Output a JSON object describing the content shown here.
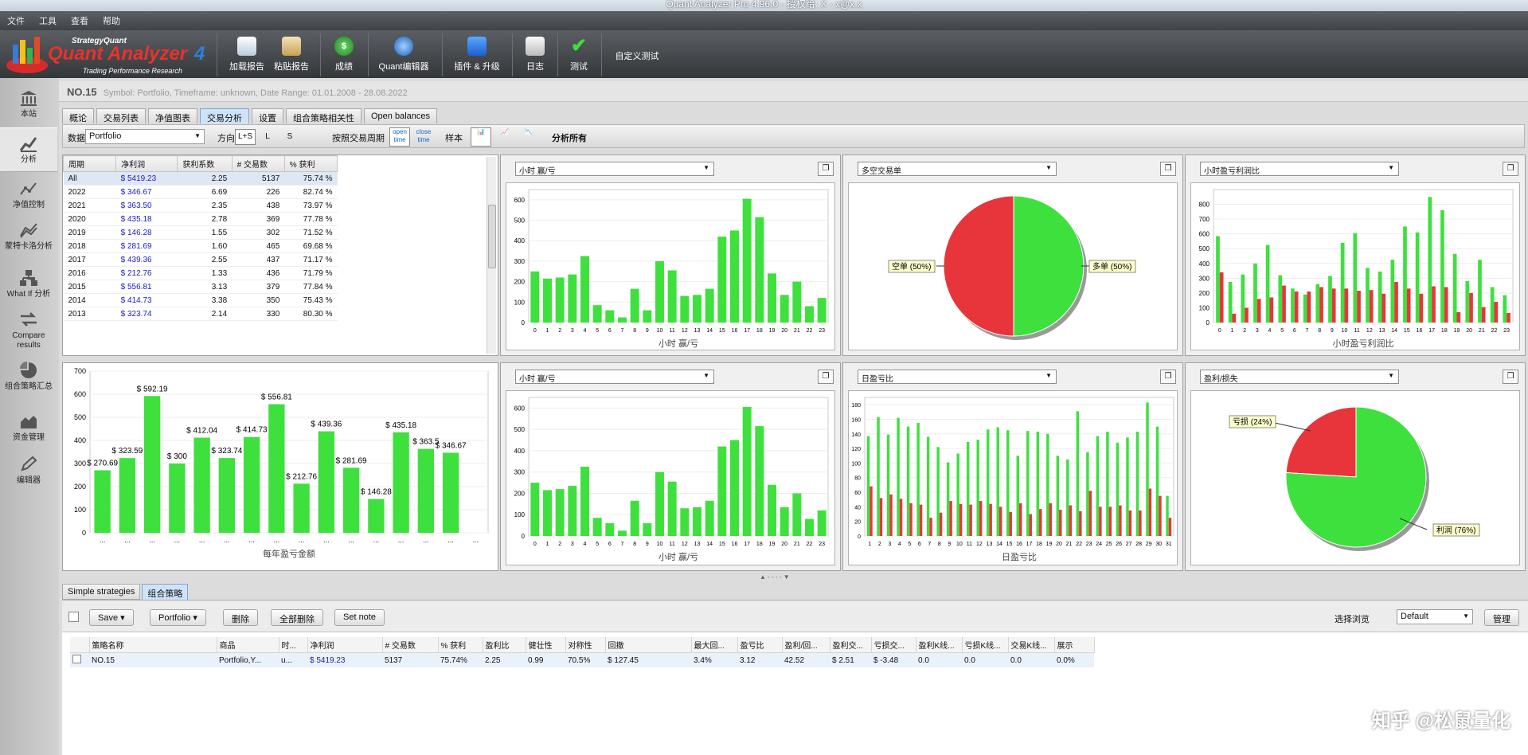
{
  "window": {
    "title": "Quant Analyzer Pro 4.96.0 - 授权给: X - x@x.x"
  },
  "menu": [
    "文件",
    "工具",
    "查看",
    "帮助"
  ],
  "logo": {
    "top": "StrategyQuant",
    "main": "Quant Analyzer",
    "num": "4",
    "sub": "Trading Performance Research"
  },
  "toolbar": [
    {
      "label": "加载报告",
      "icon": "load-icon"
    },
    {
      "label": "粘贴报告",
      "icon": "paste-icon"
    },
    {
      "label": "成绩",
      "icon": "dollar-icon"
    },
    {
      "label": "Quant编辑器",
      "icon": "globe-icon"
    },
    {
      "label": "插件 & 升级",
      "icon": "puzzle-icon"
    },
    {
      "label": "日志",
      "icon": "log-icon"
    },
    {
      "label": "测试",
      "icon": "check-icon"
    }
  ],
  "toolbar_extra": "自定义测试",
  "sidebar": [
    "本站",
    "分析",
    "净值控制",
    "蒙特卡洛分析",
    "What If 分析",
    "Compare results",
    "组合策略汇总",
    "资金管理",
    "编辑器"
  ],
  "header": {
    "name": "NO.15",
    "meta": "Symbol: Portfolio, Timeframe: unknown, Date Range: 01.01.2008 - 28.08.2022"
  },
  "tabs": [
    "概论",
    "交易列表",
    "净值图表",
    "交易分析",
    "设置",
    "组合策略相关性",
    "Open balances"
  ],
  "filter": {
    "data_label": "数据",
    "data_value": "Portfolio",
    "direction_label": "方向",
    "dirs": [
      "L+S",
      "L",
      "S"
    ],
    "period_label": "按照交易周期",
    "open_time": "open time",
    "close_time": "close time",
    "sample_label": "样本",
    "analyze_all": "分析所有"
  },
  "period_table": {
    "headers": [
      "周期",
      "净利润",
      "获利系数",
      "# 交易数",
      "% 获利"
    ],
    "rows": [
      [
        "All",
        "$ 5419.23",
        "2.25",
        "5137",
        "75.74 %"
      ],
      [
        "2022",
        "$ 346.67",
        "6.69",
        "226",
        "82.74 %"
      ],
      [
        "2021",
        "$ 363.50",
        "2.35",
        "438",
        "73.97 %"
      ],
      [
        "2020",
        "$ 435.18",
        "2.78",
        "369",
        "77.78 %"
      ],
      [
        "2019",
        "$ 146.28",
        "1.55",
        "302",
        "71.52 %"
      ],
      [
        "2018",
        "$ 281.69",
        "1.60",
        "465",
        "69.68 %"
      ],
      [
        "2017",
        "$ 439.36",
        "2.55",
        "437",
        "71.17 %"
      ],
      [
        "2016",
        "$ 212.76",
        "1.33",
        "436",
        "71.79 %"
      ],
      [
        "2015",
        "$ 556.81",
        "3.13",
        "379",
        "77.84 %"
      ],
      [
        "2014",
        "$ 414.73",
        "3.38",
        "350",
        "75.43 %"
      ],
      [
        "2013",
        "$ 323.74",
        "2.14",
        "330",
        "80.30 %"
      ]
    ]
  },
  "panels": {
    "p1": {
      "select": "小时 赢/亏",
      "xlabel": "小时 赢/亏"
    },
    "p2": {
      "select": "多空交易单",
      "short": "空单 (50%)",
      "long": "多单 (50%)"
    },
    "p3": {
      "select": "小时盈亏利润比",
      "xlabel": "小时盈亏利润比"
    },
    "p4": {
      "xlabel": "每年盈亏金额"
    },
    "p5": {
      "select": "小时 赢/亏",
      "xlabel": "小时 赢/亏"
    },
    "p6": {
      "select": "日盈亏比",
      "xlabel": "日盈亏比"
    },
    "p7": {
      "select": "盈利/损失",
      "loss": "亏损 (24%)",
      "profit": "利润 (76%)"
    }
  },
  "chart_data": [
    {
      "type": "bar",
      "id": "hourly",
      "categories": [
        "0",
        "1",
        "2",
        "3",
        "4",
        "5",
        "6",
        "7",
        "8",
        "9",
        "10",
        "11",
        "12",
        "13",
        "14",
        "15",
        "16",
        "17",
        "18",
        "19",
        "20",
        "21",
        "22",
        "23"
      ],
      "values": [
        250,
        215,
        220,
        235,
        325,
        85,
        60,
        25,
        165,
        60,
        300,
        255,
        130,
        135,
        165,
        420,
        450,
        605,
        515,
        240,
        135,
        200,
        80,
        120
      ],
      "ylim": [
        0,
        650
      ],
      "yticks": [
        0,
        100,
        200,
        300,
        400,
        500,
        600
      ]
    },
    {
      "type": "pie",
      "id": "longshort",
      "series": [
        {
          "name": "空单",
          "value": 50,
          "color": "#e8353b"
        },
        {
          "name": "多单",
          "value": 50,
          "color": "#3ee03e"
        }
      ]
    },
    {
      "type": "bar",
      "id": "hourly_pl",
      "categories": [
        "0",
        "1",
        "2",
        "3",
        "4",
        "5",
        "6",
        "7",
        "8",
        "9",
        "10",
        "11",
        "12",
        "13",
        "14",
        "15",
        "16",
        "17",
        "18",
        "19",
        "20",
        "21",
        "22",
        "23"
      ],
      "series": [
        {
          "name": "green",
          "values": [
            585,
            275,
            325,
            400,
            525,
            320,
            230,
            190,
            260,
            315,
            540,
            605,
            370,
            345,
            425,
            650,
            610,
            850,
            760,
            465,
            280,
            425,
            240,
            185
          ],
          "color": "#3ee03e"
        },
        {
          "name": "red",
          "values": [
            340,
            60,
            100,
            160,
            170,
            250,
            210,
            210,
            240,
            230,
            230,
            215,
            220,
            195,
            275,
            230,
            195,
            245,
            240,
            70,
            200,
            105,
            140,
            65
          ],
          "color": "#e8353b"
        }
      ],
      "ylim": [
        0,
        900
      ],
      "yticks": [
        0,
        100,
        200,
        300,
        400,
        500,
        600,
        700,
        800
      ]
    },
    {
      "type": "bar",
      "id": "yearly",
      "categories": [
        "...",
        "...",
        "...",
        "...",
        "...",
        "...",
        "...",
        "...",
        "...",
        "...",
        "...",
        "...",
        "...",
        "...",
        "...",
        "..."
      ],
      "values": [
        270.69,
        323.59,
        592.19,
        300,
        412.04,
        323.74,
        414.73,
        556.81,
        212.76,
        439.36,
        281.69,
        146.28,
        435.18,
        363.5,
        346.67
      ],
      "labels": [
        "$ 270.69",
        "$ 323.59",
        "$ 592.19",
        "$ 300",
        "$ 412.04",
        "$ 323.74",
        "$ 414.73",
        "$ 556.81",
        "$ 212.76",
        "$ 439.36",
        "$ 281.69",
        "$ 146.28",
        "$ 435.18",
        "$ 363.5",
        "$ 346.67"
      ],
      "ylim": [
        0,
        700
      ],
      "yticks": [
        0,
        100,
        200,
        300,
        400,
        500,
        600,
        700
      ]
    },
    {
      "type": "bar",
      "id": "hourly2",
      "categories": [
        "0",
        "1",
        "2",
        "3",
        "4",
        "5",
        "6",
        "7",
        "8",
        "9",
        "10",
        "11",
        "12",
        "13",
        "14",
        "15",
        "16",
        "17",
        "18",
        "19",
        "20",
        "21",
        "22",
        "23"
      ],
      "values": [
        250,
        215,
        220,
        235,
        325,
        85,
        60,
        25,
        165,
        60,
        300,
        255,
        130,
        135,
        165,
        420,
        450,
        605,
        515,
        240,
        135,
        200,
        80,
        120
      ],
      "ylim": [
        0,
        650
      ],
      "yticks": [
        0,
        100,
        200,
        300,
        400,
        500,
        600
      ]
    },
    {
      "type": "bar",
      "id": "daily_pl",
      "categories": [
        "1",
        "2",
        "3",
        "4",
        "5",
        "6",
        "7",
        "8",
        "9",
        "10",
        "11",
        "12",
        "13",
        "14",
        "15",
        "16",
        "17",
        "18",
        "19",
        "20",
        "21",
        "22",
        "23",
        "24",
        "25",
        "26",
        "27",
        "28",
        "29",
        "30",
        "31"
      ],
      "series": [
        {
          "name": "green",
          "values": [
            137,
            163,
            139,
            162,
            150,
            155,
            136,
            122,
            101,
            113,
            129,
            132,
            146,
            149,
            145,
            110,
            144,
            143,
            140,
            110,
            105,
            171,
            115,
            137,
            143,
            128,
            135,
            143,
            183,
            150,
            55
          ],
          "color": "#3ee03e"
        },
        {
          "name": "red",
          "values": [
            68,
            52,
            57,
            51,
            45,
            43,
            25,
            32,
            48,
            44,
            43,
            48,
            44,
            40,
            33,
            45,
            30,
            37,
            45,
            36,
            42,
            34,
            62,
            40,
            40,
            42,
            35,
            35,
            65,
            55,
            25
          ],
          "color": "#e8353b"
        }
      ],
      "ylim": [
        0,
        190
      ],
      "yticks": [
        0,
        20,
        40,
        60,
        80,
        100,
        120,
        140,
        160,
        180
      ]
    },
    {
      "type": "pie",
      "id": "profitloss",
      "series": [
        {
          "name": "亏损",
          "value": 24,
          "color": "#e8353b"
        },
        {
          "name": "利润",
          "value": 76,
          "color": "#3ee03e"
        }
      ]
    }
  ],
  "bottom": {
    "tabs": [
      "Simple strategies",
      "组合策略"
    ],
    "buttons": [
      "Save",
      "Portfolio",
      "删除",
      "全部删除",
      "Set note"
    ],
    "view_label": "选择浏览",
    "view_value": "Default",
    "manage": "管理",
    "columns": [
      "策略名称",
      "商品",
      "时...",
      "净利润",
      "# 交易数",
      "% 获利",
      "盈利比",
      "健壮性",
      "对称性",
      "回撤",
      "最大回...",
      "盈亏比",
      "盈利/回...",
      "盈利交...",
      "亏损交...",
      "盈利K线...",
      "亏损K线...",
      "交易K线...",
      "展示"
    ],
    "row": [
      "NO.15",
      "Portfolio,Y...",
      "u...",
      "$ 5419.23",
      "5137",
      "75.74%",
      "2.25",
      "0.99",
      "70.5%",
      "$ 127.45",
      "3.4%",
      "3.12",
      "42.52",
      "$ 2.51",
      "$ -3.48",
      "0.0",
      "0.0",
      "0.0",
      "0.0%"
    ]
  },
  "watermark": "知乎 @松鼠量化"
}
